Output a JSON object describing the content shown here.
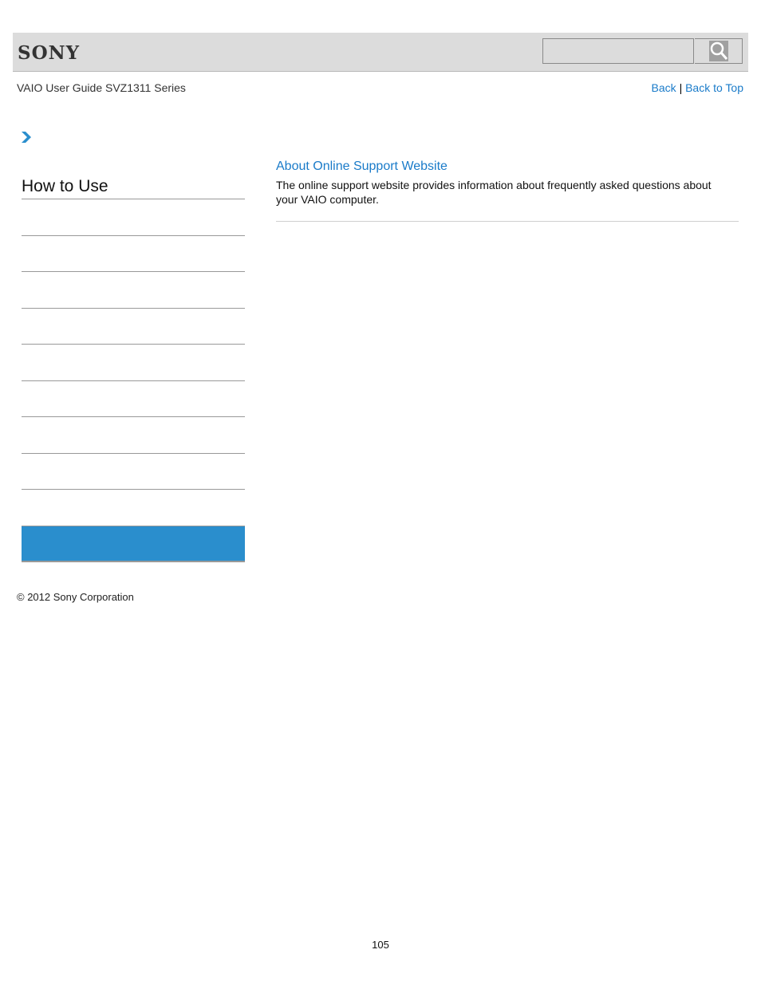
{
  "header": {
    "brand": "SONY",
    "search": {
      "value": "",
      "placeholder": ""
    },
    "search_button_icon": "search-icon"
  },
  "subheader": {
    "guide_title": "VAIO User Guide SVZ1311 Series",
    "links": {
      "back": "Back",
      "separator": "|",
      "back_to_top": "Back to Top"
    }
  },
  "sidebar": {
    "breadcrumb_icon": "chevron-right-icon",
    "title": "How to Use",
    "items": [
      "",
      "",
      "",
      "",
      "",
      "",
      "",
      "",
      ""
    ],
    "active_item": ""
  },
  "main": {
    "articles": [
      {
        "title": "About Online Support Website",
        "description": "The online support website provides information about frequently asked questions about your VAIO computer."
      }
    ]
  },
  "footer": {
    "copyright": "© 2012 Sony Corporation",
    "page_number": "105"
  },
  "colors": {
    "link": "#1a7bc9",
    "accent": "#2a8ecd",
    "header_bg": "#dcdcdc"
  }
}
